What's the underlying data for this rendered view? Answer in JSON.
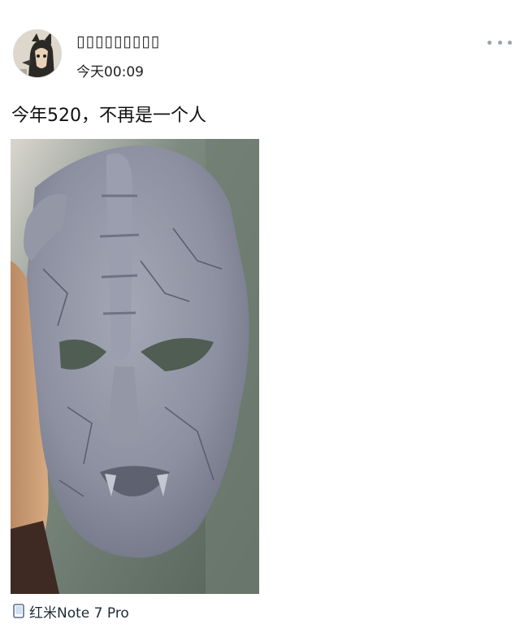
{
  "post": {
    "username": "▯▯▯▯▯▯▯▯▯",
    "time": "今天00:09",
    "text": "今年520，不再是一个人",
    "device": "红米Note 7 Pro",
    "avatar_icon": "dark-character-avatar",
    "more_icon": "more-dots-icon",
    "device_icon": "phone-icon"
  },
  "colors": {
    "text": "#111111",
    "muted": "#9aa3ad",
    "background": "#ffffff"
  }
}
